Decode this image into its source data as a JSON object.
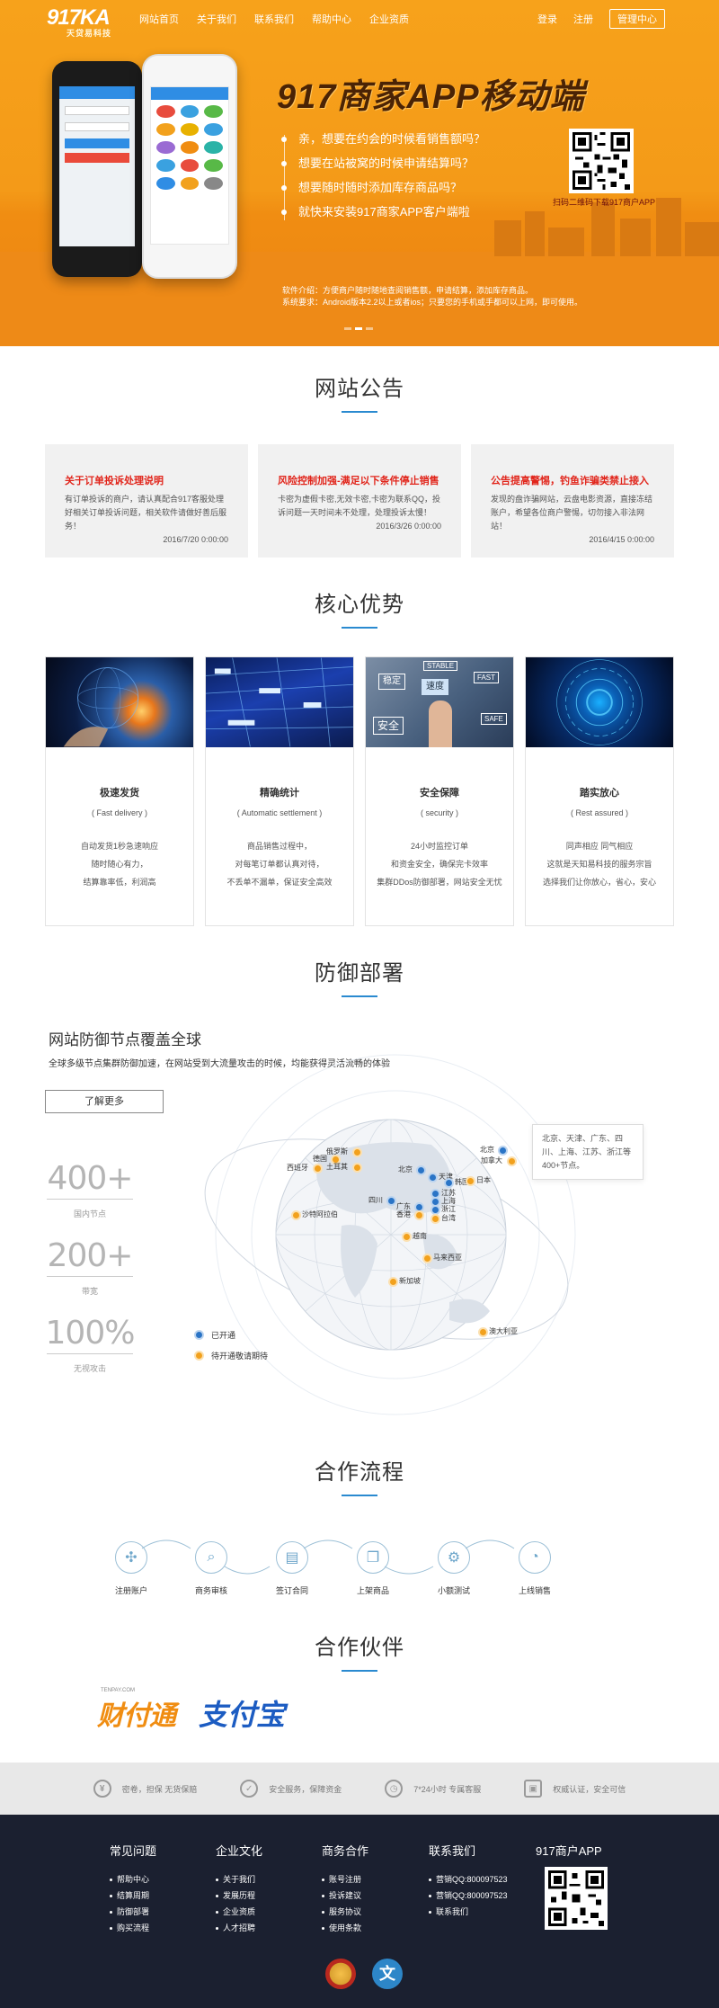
{
  "nav": {
    "logo": "917KA",
    "logo_sub": "天贷易科技",
    "links": [
      "网站首页",
      "关于我们",
      "联系我们",
      "帮助中心",
      "企业资质"
    ],
    "login": "登录",
    "register": "注册",
    "admin": "管理中心"
  },
  "hero": {
    "title": "917商家APP移动端",
    "bullets": [
      "亲，想要在约会的时候看销售额吗？",
      "想要在站被窝的时候申请结算吗？",
      "想要随时随时添加库存商品吗？",
      "就快来安装917商家APP客户端啦"
    ],
    "qr_caption": "扫码二维码下载917商户APP",
    "desc1": "软件介绍：方便商户随时随地查阅销售额，申请结算，添加库存商品。",
    "desc2": "系统要求：Android版本2.2以上或者ios；只要您的手机或手都可以上网，即可使用。",
    "colors": {
      "orange": "#f49a18",
      "title": "#4a2305"
    }
  },
  "notice_section": {
    "title": "网站公告",
    "items": [
      {
        "title": "关于订单投诉处理说明",
        "body": "有订单投诉的商户，请认真配合917客服处理好相关订单投诉问题，相关软件请做好善后服务！",
        "date": "2016/7/20 0:00:00"
      },
      {
        "title": "风险控制加强-满足以下条件停止销售",
        "body": "卡密为虚假卡密,无效卡密,卡密为联系QQ，投诉问题一天时间未不处理，处理投诉太慢！",
        "date": "2016/3/26 0:00:00"
      },
      {
        "title": "公告提高警惕，钓鱼诈骗类禁止接入",
        "body": "发现的盘诈骗网站，云盘电影资源，直接冻结账户，希望各位商户警惕，切勿接入非法网站！",
        "date": "2016/4/15 0:00:00"
      }
    ]
  },
  "advantage_section": {
    "title": "核心优势",
    "cards": [
      {
        "title": "极速发货",
        "en": "( Fast delivery )",
        "lines": [
          "自动发货1秒急速响应",
          "随时随心有力，",
          "结算靠率低，利润高"
        ]
      },
      {
        "title": "精确统计",
        "en": "( Automatic settlement )",
        "lines": [
          "商品销售过程中，",
          "对每笔订单都认真对待，",
          "不丢单不漏单，保证安全高效"
        ]
      },
      {
        "title": "安全保障",
        "en": "( security )",
        "lines": [
          "24小时监控订单",
          "和资金安全，确保完卡效率",
          "集群DDos防御部署，网站安全无忧"
        ]
      },
      {
        "title": "踏实放心",
        "en": "( Rest assured )",
        "lines": [
          "同声相应 同气相应",
          "这就是天知易科技的服务宗旨",
          "选择我们让你放心，省心，安心"
        ]
      }
    ],
    "img_texts": {
      "stable": "STABLE",
      "steady": "稳定",
      "fast": "FAST",
      "speed": "速度",
      "safe": "安全",
      "note": "SAFE"
    }
  },
  "defense_section": {
    "title": "防御部署",
    "heading": "网站防御节点覆盖全球",
    "sub": "全球多级节点集群防御加速，在网站受到大流量攻击的时候，均能获得灵活流畅的体验",
    "more": "了解更多",
    "stats": [
      {
        "value": "400+",
        "label": "国内节点"
      },
      {
        "value": "200+",
        "label": "带宽"
      },
      {
        "value": "100%",
        "label": "无视攻击"
      }
    ],
    "popup": "北京、天津、广东、四川、上海、江苏、浙江等400+节点。",
    "legend": [
      {
        "label": "已开通",
        "color": "#2a74c6"
      },
      {
        "label": "待开通敬请期待",
        "color": "#f2a11d"
      }
    ],
    "cities": [
      "北京",
      "加拿大",
      "俄罗斯",
      "德国",
      "土耳其",
      "西班牙",
      "北京",
      "天津",
      "韩国",
      "日本",
      "四川",
      "江苏",
      "上海",
      "浙江",
      "广东",
      "台湾",
      "香港",
      "越南",
      "沙特阿拉伯",
      "马来西亚",
      "新加坡",
      "澳大利亚"
    ]
  },
  "flow_section": {
    "title": "合作流程",
    "steps": [
      "注册账户",
      "商务审核",
      "签订合同",
      "上架商品",
      "小额测试",
      "上线销售"
    ]
  },
  "partner_section": {
    "title": "合作伙伴",
    "partners": [
      "财付通",
      "支付宝"
    ],
    "partner1_tag": "TENPAY.COM"
  },
  "services": [
    "密卷，担保 无货保赔",
    "安全服务，保障资金",
    "7*24小时 专属客服",
    "权威认证，安全可信"
  ],
  "footer": {
    "cols": [
      {
        "title": "常见问题",
        "items": [
          "帮助中心",
          "结算周期",
          "防御部署",
          "购买流程"
        ]
      },
      {
        "title": "企业文化",
        "items": [
          "关于我们",
          "发展历程",
          "企业资质",
          "人才招聘"
        ]
      },
      {
        "title": "商务合作",
        "items": [
          "账号注册",
          "投诉建议",
          "服务协议",
          "使用条款"
        ]
      },
      {
        "title": "联系我们",
        "items": [
          "营销QQ:800097523",
          "营销QQ:800097523",
          "联系我们"
        ]
      }
    ],
    "app_title": "917商户APP",
    "badge2": "文"
  }
}
